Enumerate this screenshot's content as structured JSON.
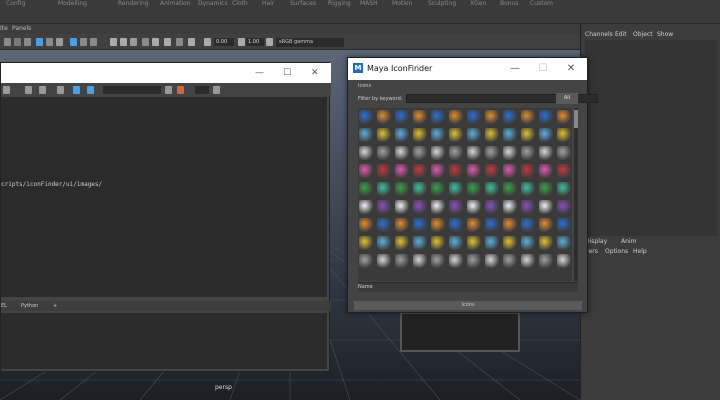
{
  "menubar": {
    "items": [
      "Config",
      "Modelling",
      "Rendering",
      "Animation",
      "Dynamics",
      "Cloth",
      "Hair",
      "Surfaces",
      "Rigging",
      "MASH",
      "Motion",
      "Sculpting",
      "XGen",
      "Bonus",
      "Custom"
    ]
  },
  "menu2": {
    "items": [
      "Ite",
      "Panels"
    ]
  },
  "shelf": {
    "num1": "0.00",
    "num2": "1.00",
    "gamma": "sRGB gamma"
  },
  "right_panel": {
    "tabs": [
      "Channels",
      "Edit",
      "Object",
      "Show"
    ],
    "layer_tabs": [
      "Display",
      "Anim"
    ],
    "layer_menu": [
      "yers",
      "Options",
      "Help"
    ]
  },
  "viewport": {
    "camera_label": "persp"
  },
  "script_editor": {
    "history_path": "cripts/iconFinder/ui/images/",
    "tabs": [
      "EL",
      "Python",
      "+"
    ]
  },
  "icon_finder": {
    "title": "Maya IconFinder",
    "icons_label": "Icons",
    "filter_label": "Filter by keyword:",
    "filter_value": "",
    "all_button": "All",
    "name_label": "Name",
    "bottom_label": "Icons",
    "brand_color": "#1e6fb8",
    "icon_colors": [
      "#2b6fd6",
      "#e0c030",
      "#d8d8d8",
      "#c03a3a",
      "#3aa04a",
      "#8a50c0",
      "#e08a30",
      "#5ab0e0",
      "#a0a0a0",
      "#e05ab0",
      "#40c0a0",
      "#f0f0f0"
    ]
  }
}
